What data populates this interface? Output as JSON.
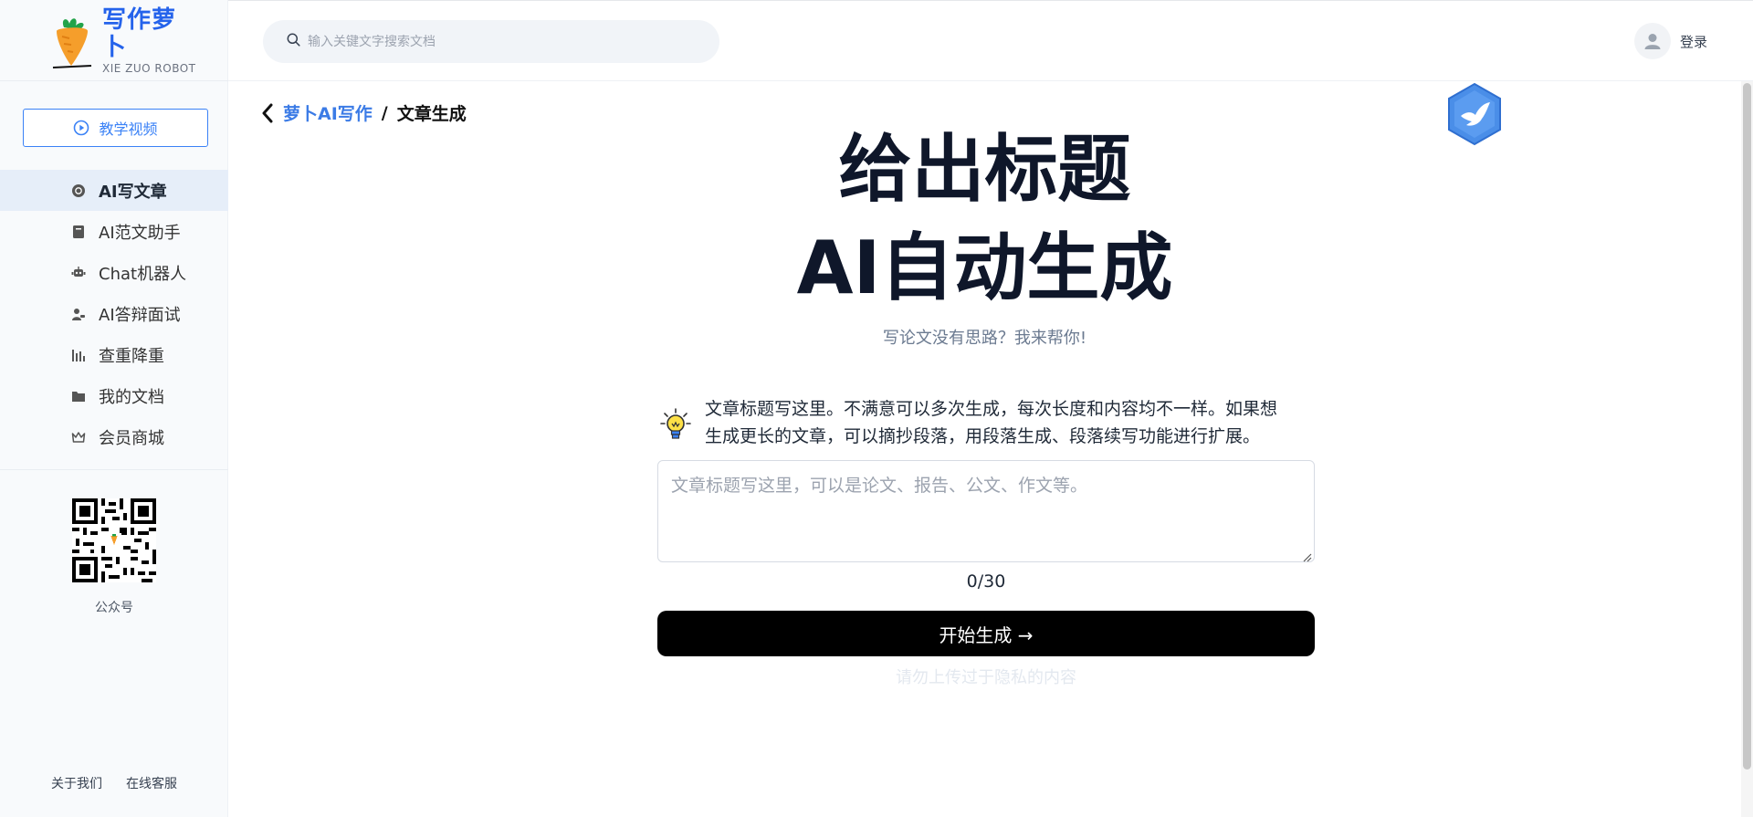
{
  "brand": {
    "name": "写作萝卜",
    "subtitle": "XIE ZUO ROBOT",
    "colors": {
      "primary": "#2563eb",
      "accent_orange": "#f59e2b",
      "leaf_green": "#22a34a"
    }
  },
  "sidebar": {
    "tutorial_button": "教学视频",
    "items": [
      {
        "label": "AI写文章",
        "icon": "chatgpt-icon",
        "active": true
      },
      {
        "label": "AI范文助手",
        "icon": "book-icon",
        "active": false
      },
      {
        "label": "Chat机器人",
        "icon": "robot-icon",
        "active": false
      },
      {
        "label": "AI答辩面试",
        "icon": "interview-icon",
        "active": false
      },
      {
        "label": "查重降重",
        "icon": "bars-icon",
        "active": false
      },
      {
        "label": "我的文档",
        "icon": "folder-icon",
        "active": false
      },
      {
        "label": "会员商城",
        "icon": "crown-icon",
        "active": false
      }
    ],
    "qr_label": "公众号",
    "footer": {
      "about": "关于我们",
      "support": "在线客服"
    }
  },
  "topbar": {
    "search_placeholder": "输入关键文字搜索文档",
    "login": "登录"
  },
  "breadcrumb": {
    "parent": "萝卜AI写作",
    "separator": "/",
    "current": "文章生成"
  },
  "hero": {
    "line1": "给出标题",
    "line2": "AI自动生成",
    "subtitle": "写论文没有思路？我来帮你!"
  },
  "form": {
    "tip_line1": "文章标题写这里。不满意可以多次生成，每次长度和内容均不一样。如果想",
    "tip_line2": "生成更长的文章，可以摘抄段落，用段落生成、段落续写功能进行扩展。",
    "title_placeholder": "文章标题写这里，可以是论文、报告、公文、作文等。",
    "title_value": "",
    "counter": "0/30",
    "generate_button": "开始生成 →",
    "privacy_note": "请勿上传过于隐私的内容"
  }
}
